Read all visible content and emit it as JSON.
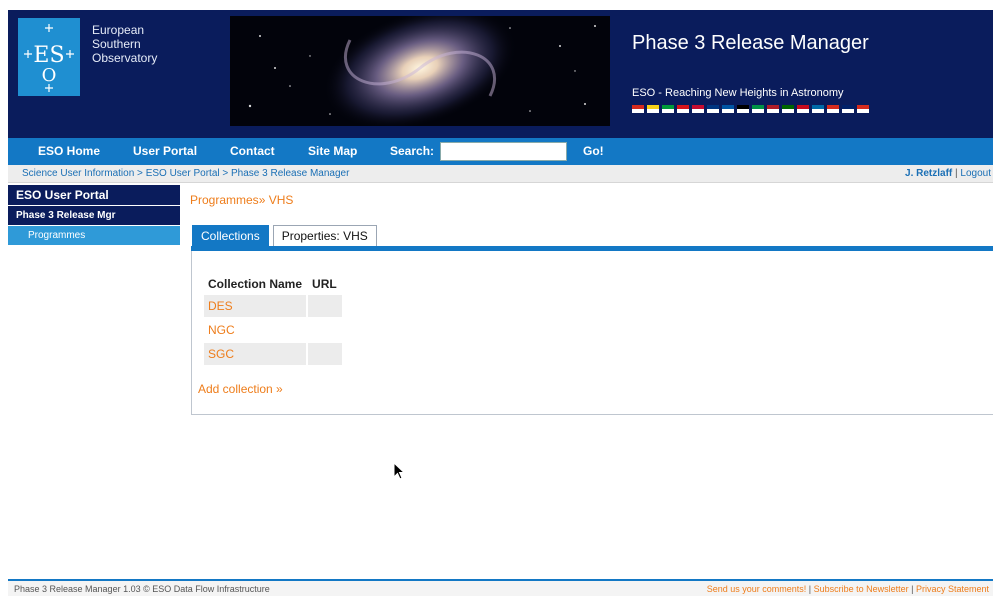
{
  "header": {
    "org_lines": [
      "European",
      "Southern",
      "Observatory"
    ],
    "title": "Phase 3 Release Manager",
    "tagline": "ESO - Reaching New Heights in Astronomy",
    "brand_color": "#0a1c5c",
    "accent_color": "#1378c5"
  },
  "nav": {
    "items": [
      "ESO Home",
      "User Portal",
      "Contact",
      "Site Map"
    ],
    "search_label": "Search:",
    "search_value": "",
    "go_label": "Go!"
  },
  "breadcrumb": {
    "items": [
      "Science User Information",
      "ESO User Portal",
      "Phase 3 Release Manager"
    ],
    "separator": " > "
  },
  "user": {
    "name": "J. Retzlaff",
    "logout": "Logout",
    "divider": " | "
  },
  "sidebar": {
    "portal": "ESO User Portal",
    "section": "Phase 3 Release Mgr",
    "items": [
      "Programmes"
    ]
  },
  "main": {
    "programmes_link": "Programmes",
    "current_programme": "» VHS",
    "tabs": [
      "Collections",
      "Properties: VHS"
    ],
    "active_tab": "Collections",
    "table": {
      "columns": [
        "Collection Name",
        "URL"
      ],
      "rows": [
        {
          "name": "DES",
          "url": ""
        },
        {
          "name": "NGC",
          "url": ""
        },
        {
          "name": "SGC",
          "url": ""
        }
      ]
    },
    "add_collection": "Add collection »"
  },
  "footer": {
    "left": "Phase 3 Release Manager 1.03 © ESO Data Flow Infrastructure",
    "links": [
      "Send us your comments!",
      "Subscribe to Newsletter",
      "Privacy Statement"
    ],
    "divider": " | "
  },
  "flags": [
    "#d52b1e",
    "#f7d117",
    "#009b3a",
    "#d7141a",
    "#c60c30",
    "#003580",
    "#0055a4",
    "#000000",
    "#009246",
    "#ae1c28",
    "#006600",
    "#c60b1e",
    "#006aa7",
    "#d52b1e",
    "#012169",
    "#d52b1e"
  ]
}
